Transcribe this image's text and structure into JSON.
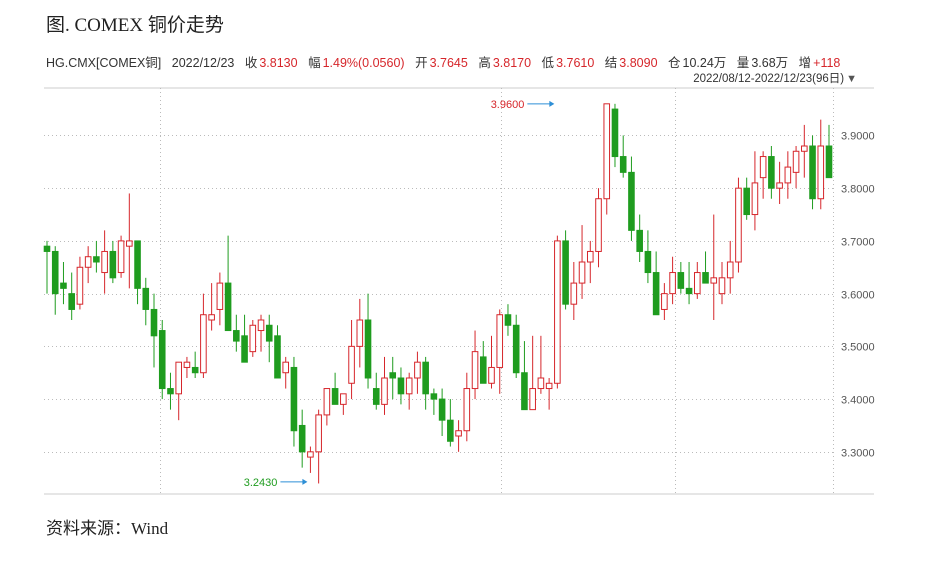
{
  "figure": {
    "title": "图. COMEX 铜价走势",
    "source": "资料来源：Wind"
  },
  "quote": {
    "symbol": "HG.CMX[COMEX铜]",
    "date": "2022/12/23",
    "close_label": "收",
    "close": "3.8130",
    "change_label": "幅",
    "change": "1.49%(0.0560)",
    "open_label": "开",
    "open": "3.7645",
    "high_label": "高",
    "high": "3.8170",
    "low_label": "低",
    "low": "3.7610",
    "settle_label": "结",
    "settle": "3.8090",
    "oi_label": "仓",
    "oi": "10.24万",
    "volume_label": "量",
    "volume": "3.68万",
    "increase_label": "增",
    "increase": "+118"
  },
  "date_range": "2022/08/12-2022/12/23(96日)",
  "colors": {
    "up": "#d6262b",
    "down": "#1f9c1f",
    "grid": "#bbbbbb",
    "marker": "#2e8fd6"
  },
  "chart_data": {
    "type": "candlestick",
    "yticks": [
      "3.3000",
      "3.4000",
      "3.5000",
      "3.6000",
      "3.7000",
      "3.8000",
      "3.9000"
    ],
    "ylim": [
      3.22,
      3.99
    ],
    "grid": true,
    "annotations": [
      {
        "label": "3.9600",
        "value": 3.96,
        "type": "max",
        "index": 62
      },
      {
        "label": "3.2430",
        "value": 3.243,
        "type": "min",
        "index": 32
      }
    ],
    "candles": [
      [
        3.69,
        3.7,
        3.6,
        3.68
      ],
      [
        3.68,
        3.69,
        3.56,
        3.6
      ],
      [
        3.62,
        3.66,
        3.58,
        3.61
      ],
      [
        3.6,
        3.64,
        3.55,
        3.57
      ],
      [
        3.58,
        3.67,
        3.57,
        3.65
      ],
      [
        3.65,
        3.69,
        3.62,
        3.67
      ],
      [
        3.67,
        3.7,
        3.64,
        3.66
      ],
      [
        3.64,
        3.72,
        3.6,
        3.68
      ],
      [
        3.68,
        3.7,
        3.62,
        3.63
      ],
      [
        3.64,
        3.71,
        3.63,
        3.7
      ],
      [
        3.69,
        3.79,
        3.61,
        3.7
      ],
      [
        3.7,
        3.7,
        3.58,
        3.61
      ],
      [
        3.61,
        3.63,
        3.54,
        3.57
      ],
      [
        3.57,
        3.6,
        3.46,
        3.52
      ],
      [
        3.53,
        3.55,
        3.4,
        3.42
      ],
      [
        3.42,
        3.45,
        3.38,
        3.41
      ],
      [
        3.41,
        3.47,
        3.36,
        3.47
      ],
      [
        3.46,
        3.48,
        3.44,
        3.47
      ],
      [
        3.46,
        3.49,
        3.44,
        3.45
      ],
      [
        3.45,
        3.6,
        3.44,
        3.56
      ],
      [
        3.55,
        3.62,
        3.53,
        3.56
      ],
      [
        3.57,
        3.64,
        3.54,
        3.62
      ],
      [
        3.62,
        3.71,
        3.56,
        3.53
      ],
      [
        3.53,
        3.56,
        3.49,
        3.51
      ],
      [
        3.52,
        3.56,
        3.47,
        3.47
      ],
      [
        3.49,
        3.55,
        3.48,
        3.54
      ],
      [
        3.53,
        3.56,
        3.49,
        3.55
      ],
      [
        3.54,
        3.56,
        3.47,
        3.51
      ],
      [
        3.52,
        3.54,
        3.46,
        3.44
      ],
      [
        3.45,
        3.48,
        3.42,
        3.47
      ],
      [
        3.46,
        3.48,
        3.31,
        3.34
      ],
      [
        3.35,
        3.38,
        3.27,
        3.3
      ],
      [
        3.29,
        3.31,
        3.26,
        3.3
      ],
      [
        3.3,
        3.38,
        3.24,
        3.37
      ],
      [
        3.37,
        3.42,
        3.35,
        3.42
      ],
      [
        3.42,
        3.45,
        3.39,
        3.39
      ],
      [
        3.39,
        3.41,
        3.37,
        3.41
      ],
      [
        3.43,
        3.55,
        3.4,
        3.5
      ],
      [
        3.5,
        3.59,
        3.46,
        3.55
      ],
      [
        3.55,
        3.6,
        3.42,
        3.44
      ],
      [
        3.42,
        3.45,
        3.38,
        3.39
      ],
      [
        3.39,
        3.48,
        3.37,
        3.44
      ],
      [
        3.45,
        3.48,
        3.4,
        3.44
      ],
      [
        3.44,
        3.46,
        3.39,
        3.41
      ],
      [
        3.41,
        3.45,
        3.38,
        3.44
      ],
      [
        3.44,
        3.49,
        3.41,
        3.47
      ],
      [
        3.47,
        3.48,
        3.38,
        3.41
      ],
      [
        3.41,
        3.42,
        3.37,
        3.4
      ],
      [
        3.4,
        3.42,
        3.33,
        3.36
      ],
      [
        3.36,
        3.4,
        3.31,
        3.32
      ],
      [
        3.33,
        3.36,
        3.3,
        3.34
      ],
      [
        3.34,
        3.45,
        3.32,
        3.42
      ],
      [
        3.42,
        3.53,
        3.4,
        3.49
      ],
      [
        3.48,
        3.51,
        3.44,
        3.43
      ],
      [
        3.43,
        3.52,
        3.42,
        3.46
      ],
      [
        3.46,
        3.57,
        3.41,
        3.56
      ],
      [
        3.56,
        3.58,
        3.52,
        3.54
      ],
      [
        3.54,
        3.56,
        3.44,
        3.45
      ],
      [
        3.45,
        3.51,
        3.38,
        3.38
      ],
      [
        3.38,
        3.52,
        3.38,
        3.42
      ],
      [
        3.42,
        3.52,
        3.41,
        3.44
      ],
      [
        3.42,
        3.44,
        3.38,
        3.43
      ],
      [
        3.43,
        3.71,
        3.42,
        3.7
      ],
      [
        3.7,
        3.72,
        3.57,
        3.58
      ],
      [
        3.58,
        3.66,
        3.55,
        3.62
      ],
      [
        3.62,
        3.73,
        3.59,
        3.66
      ],
      [
        3.66,
        3.7,
        3.62,
        3.68
      ],
      [
        3.68,
        3.8,
        3.65,
        3.78
      ],
      [
        3.78,
        3.96,
        3.75,
        3.96
      ],
      [
        3.95,
        3.96,
        3.84,
        3.86
      ],
      [
        3.86,
        3.9,
        3.82,
        3.83
      ],
      [
        3.83,
        3.86,
        3.7,
        3.72
      ],
      [
        3.72,
        3.75,
        3.66,
        3.68
      ],
      [
        3.68,
        3.72,
        3.62,
        3.64
      ],
      [
        3.64,
        3.68,
        3.56,
        3.56
      ],
      [
        3.57,
        3.62,
        3.55,
        3.6
      ],
      [
        3.6,
        3.67,
        3.58,
        3.64
      ],
      [
        3.64,
        3.66,
        3.6,
        3.61
      ],
      [
        3.61,
        3.66,
        3.58,
        3.6
      ],
      [
        3.6,
        3.66,
        3.59,
        3.64
      ],
      [
        3.64,
        3.68,
        3.62,
        3.62
      ],
      [
        3.62,
        3.75,
        3.55,
        3.63
      ],
      [
        3.6,
        3.66,
        3.58,
        3.63
      ],
      [
        3.63,
        3.7,
        3.6,
        3.66
      ],
      [
        3.66,
        3.82,
        3.64,
        3.8
      ],
      [
        3.8,
        3.82,
        3.74,
        3.75
      ],
      [
        3.75,
        3.87,
        3.72,
        3.81
      ],
      [
        3.82,
        3.87,
        3.78,
        3.86
      ],
      [
        3.86,
        3.88,
        3.78,
        3.8
      ],
      [
        3.8,
        3.85,
        3.77,
        3.81
      ],
      [
        3.81,
        3.87,
        3.78,
        3.84
      ],
      [
        3.83,
        3.88,
        3.8,
        3.87
      ],
      [
        3.87,
        3.92,
        3.82,
        3.88
      ],
      [
        3.88,
        3.9,
        3.76,
        3.78
      ],
      [
        3.78,
        3.93,
        3.76,
        3.88
      ],
      [
        3.88,
        3.92,
        3.84,
        3.82
      ]
    ]
  }
}
